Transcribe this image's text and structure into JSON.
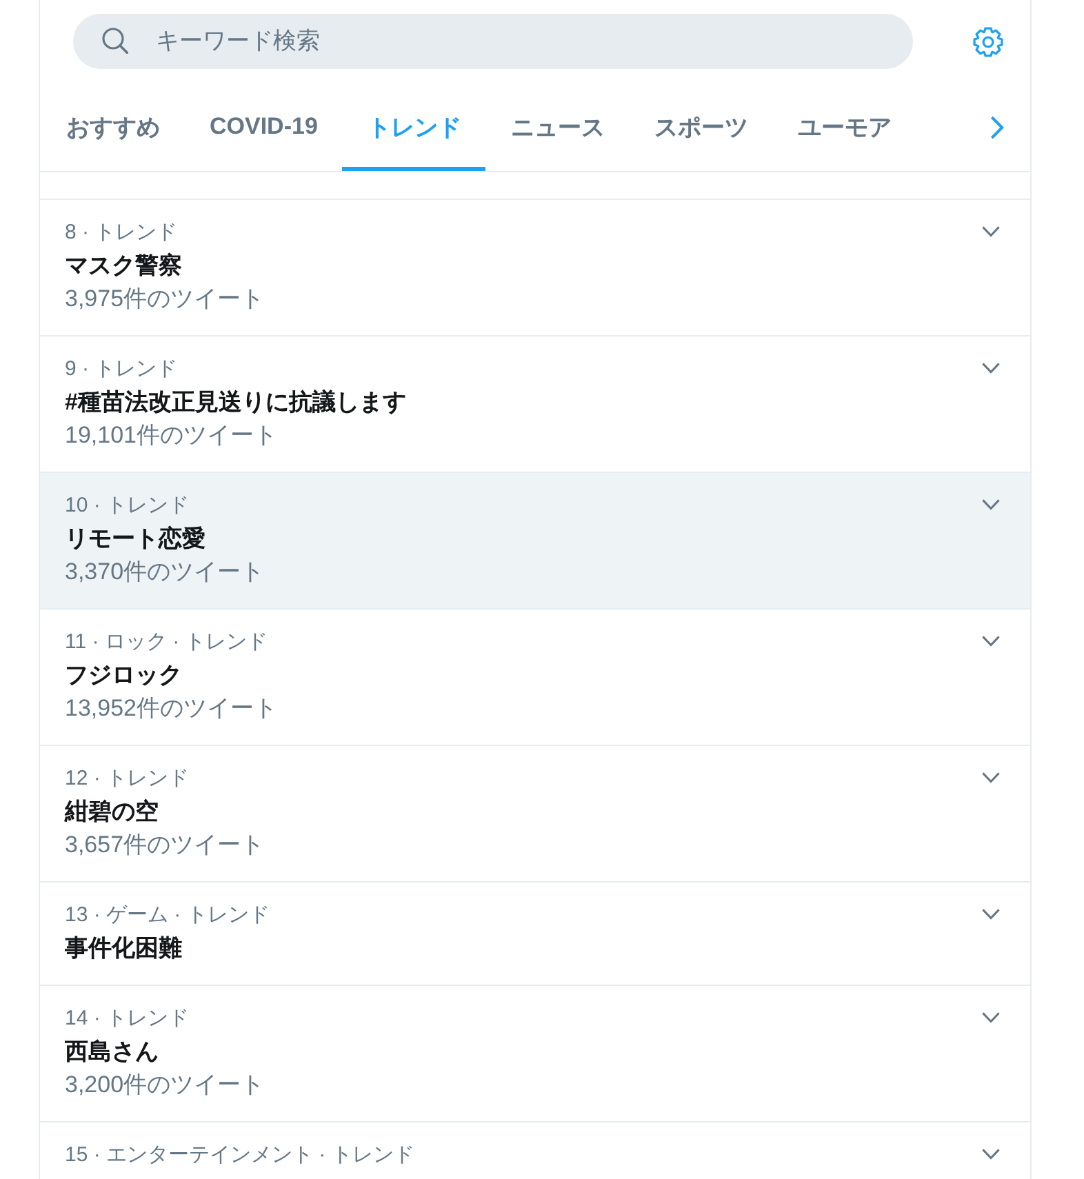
{
  "search": {
    "placeholder": "キーワード検索"
  },
  "tabs": [
    {
      "label": "おすすめ",
      "selected": false
    },
    {
      "label": "COVID-19",
      "selected": false
    },
    {
      "label": "トレンド",
      "selected": true
    },
    {
      "label": "ニュース",
      "selected": false
    },
    {
      "label": "スポーツ",
      "selected": false
    },
    {
      "label": "ユーモア",
      "selected": false
    }
  ],
  "trends": [
    {
      "context": "8 · トレンド",
      "title": "マスク警察",
      "tweet_count": "3,975件のツイート",
      "highlighted": false
    },
    {
      "context": "9 · トレンド",
      "title": "#種苗法改正見送りに抗議します",
      "tweet_count": "19,101件のツイート",
      "highlighted": false
    },
    {
      "context": "10 · トレンド",
      "title": "リモート恋愛",
      "tweet_count": "3,370件のツイート",
      "highlighted": true
    },
    {
      "context": "11 · ロック · トレンド",
      "title": "フジロック",
      "tweet_count": "13,952件のツイート",
      "highlighted": false
    },
    {
      "context": "12 · トレンド",
      "title": "紺碧の空",
      "tweet_count": "3,657件のツイート",
      "highlighted": false
    },
    {
      "context": "13 · ゲーム · トレンド",
      "title": "事件化困難",
      "highlighted": false
    },
    {
      "context": "14 · トレンド",
      "title": "西島さん",
      "tweet_count": "3,200件のツイート",
      "highlighted": false
    },
    {
      "context": "15 · エンターテインメント · トレンド",
      "highlighted": false
    }
  ]
}
